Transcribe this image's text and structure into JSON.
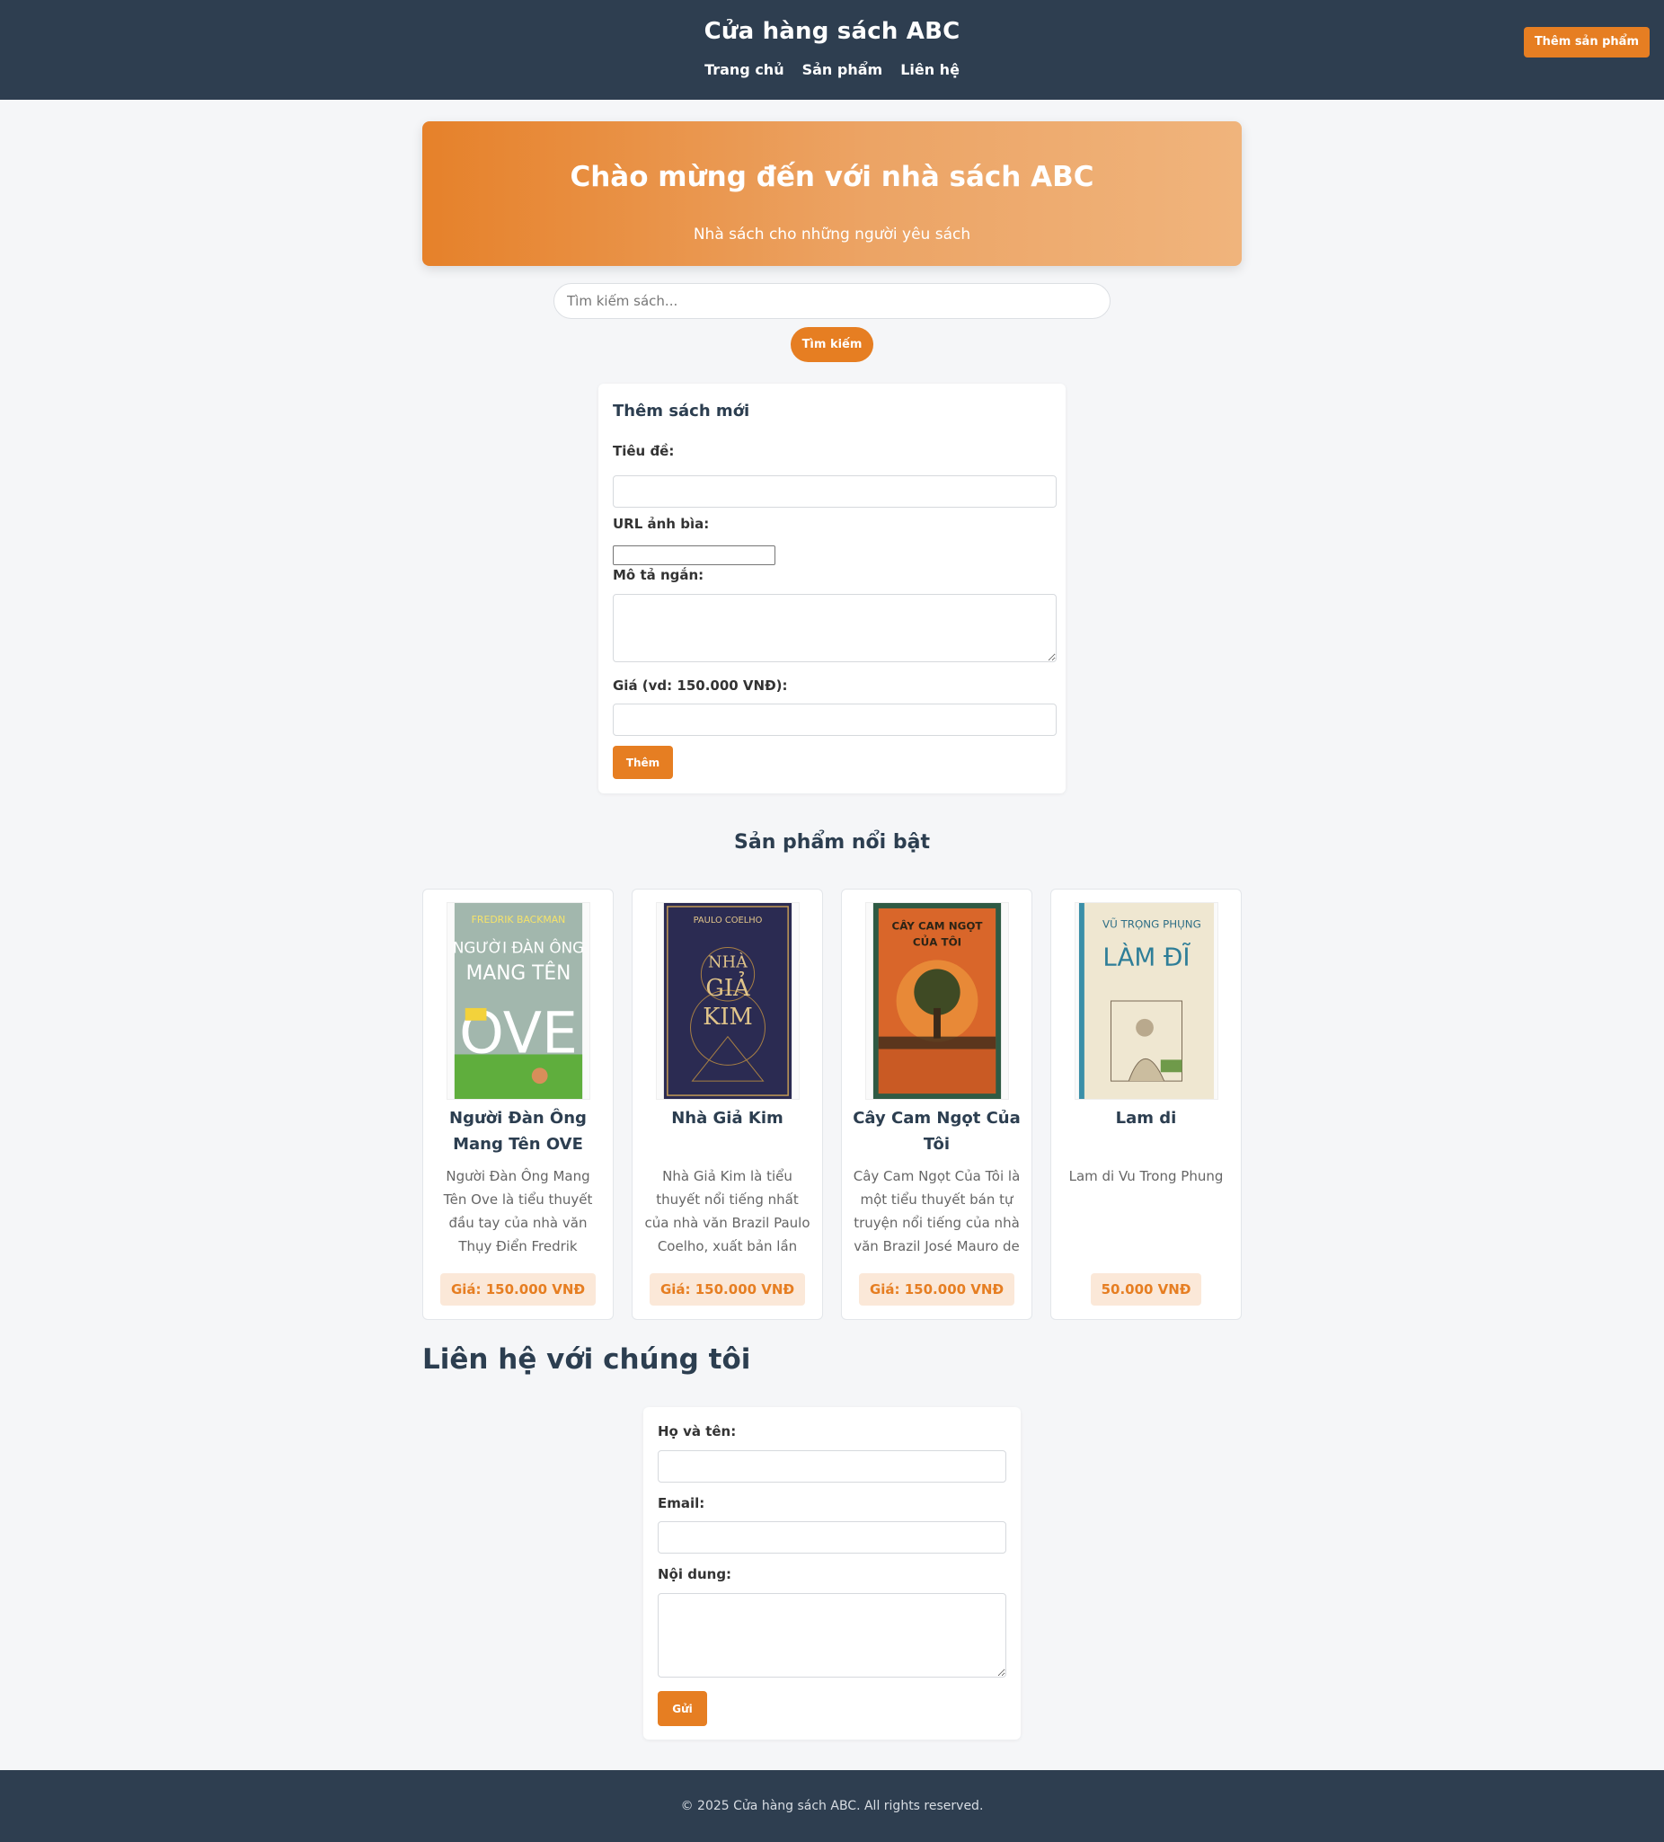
{
  "header": {
    "brand": "Cửa hàng sách ABC",
    "nav": [
      "Trang chủ",
      "Sản phẩm",
      "Liên hệ"
    ],
    "add_product_label": "Thêm sản phẩm"
  },
  "hero": {
    "title": "Chào mừng đến với nhà sách ABC",
    "subtitle": "Nhà sách cho những người yêu sách"
  },
  "search": {
    "placeholder": "Tìm kiếm sách...",
    "value": "",
    "button_label": "Tìm kiếm"
  },
  "add_book_form": {
    "title": "Thêm sách mới",
    "title_label": "Tiêu đề:",
    "cover_url_label": "URL ảnh bìa:",
    "desc_label": "Mô tả ngắn:",
    "price_label": "Giá (vd: 150.000 VNĐ):",
    "submit_label": "Thêm"
  },
  "products": {
    "section_title": "Sản phẩm nổi bật",
    "items": [
      {
        "title": "Người Đàn Ông Mang Tên OVE",
        "description": "Người Đàn Ông Mang Tên Ove là tiểu thuyết đầu tay của nhà văn Thụy Điển Fredrik Backman...",
        "price": "Giá: 150.000 VNĐ",
        "cover": {
          "author": "FREDRIK BACKMAN",
          "title_line1": "NGƯỜI ĐÀN ÔNG",
          "title_line2": "MANG TÊN",
          "title_line3": "OVE",
          "color": "#9fb3a8"
        }
      },
      {
        "title": "Nhà Giả Kim",
        "description": "Nhà Giả Kim là tiểu thuyết nổi tiếng nhất của nhà văn Brazil Paulo Coelho, xuất bản lần đầu...",
        "price": "Giá: 150.000 VNĐ",
        "cover": {
          "author": "PAULO COELHO",
          "title_line1": "NHÀ",
          "title_line2": "GIẢ",
          "title_line3": "KIM",
          "color": "#2a2a4a"
        }
      },
      {
        "title": "Cây Cam Ngọt Của Tôi",
        "description": "Cây Cam Ngọt Của Tôi là một tiểu thuyết bán tự truyện nổi tiếng của nhà văn Brazil José Mauro de Vasconcelos...",
        "price": "Giá: 150.000 VNĐ",
        "cover": {
          "author": "",
          "title_line1": "CÂY CAM NGỌT",
          "title_line2": "CỦA TÔI",
          "title_line3": "",
          "color": "#d9662a"
        }
      },
      {
        "title": "Lam di",
        "description": "Lam di Vu Trong Phung",
        "price": "50.000 VNĐ",
        "cover": {
          "author": "VŨ TRỌNG PHỤNG",
          "title_line1": "LÀM ĐĨ",
          "title_line2": "",
          "title_line3": "",
          "color": "#efe6cf"
        }
      }
    ]
  },
  "contact": {
    "section_title": "Liên hệ với chúng tôi",
    "name_label": "Họ và tên:",
    "email_label": "Email:",
    "message_label": "Nội dung:",
    "submit_label": "Gửi"
  },
  "footer": {
    "text": "© 2025 Cửa hàng sách ABC. All rights reserved."
  }
}
